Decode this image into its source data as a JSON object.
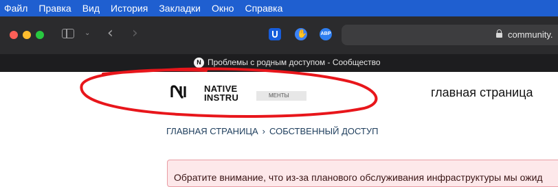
{
  "menubar": {
    "items": [
      "Файл",
      "Правка",
      "Вид",
      "История",
      "Закладки",
      "Окно",
      "Справка"
    ]
  },
  "toolbar": {
    "extensions": [
      "bitwarden-icon",
      "hand-icon",
      "adblock-plus-icon"
    ],
    "abp_label": "ABP",
    "url": "community.",
    "colors": {
      "menubar": "#1f5fd0",
      "toolbar": "#2b2b2d",
      "tabbar": "#1d1d1f"
    }
  },
  "tab": {
    "favicon": "N",
    "title": "Проблемы с родным доступом - Сообщество"
  },
  "site": {
    "logo_line1": "NATIVE",
    "logo_line2": "INSTRU",
    "logo_menu": "МЕНТЫ",
    "home_title": "главная страница"
  },
  "breadcrumb": {
    "home": "ГЛАВНАЯ СТРАНИЦА",
    "separator": "›",
    "current": "СОБСТВЕННЫЙ ДОСТУП"
  },
  "alert": {
    "text": "Обратите внимание, что из-за планового обслуживания инфраструктуры мы ожид"
  }
}
